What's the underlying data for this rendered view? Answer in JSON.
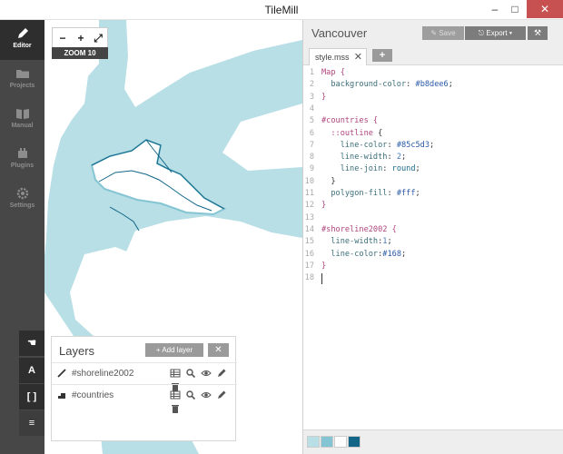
{
  "window": {
    "title": "TileMill",
    "minimize": "–",
    "maximize": "□",
    "close": "✕"
  },
  "sidebar": {
    "items": [
      {
        "label": "Editor",
        "icon": "pencil-icon",
        "active": true
      },
      {
        "label": "Projects",
        "icon": "folder-icon",
        "active": false
      },
      {
        "label": "Manual",
        "icon": "book-icon",
        "active": false
      },
      {
        "label": "Plugins",
        "icon": "plugin-icon",
        "active": false
      },
      {
        "label": "Settings",
        "icon": "gear-icon",
        "active": false
      }
    ]
  },
  "map_tools": {
    "zoom_out": "−",
    "zoom_in": "+",
    "fullscreen": "⤢",
    "zoom_label": "ZOOM 10",
    "pan": "☚",
    "text": "A",
    "braces": "[ ]",
    "layers": "≡"
  },
  "layers_panel": {
    "title": "Layers",
    "add_label": "Add layer",
    "close_label": "✕",
    "layers": [
      {
        "name": "#shoreline2002",
        "icon": "line-icon"
      },
      {
        "name": "#countries",
        "icon": "polygon-icon"
      }
    ]
  },
  "editor": {
    "project_title": "Vancouver",
    "save_label": "Save",
    "export_label": "Export",
    "tab_name": "style.mss",
    "tab_close": "✕",
    "tab_add": "+",
    "lines": [
      {
        "n": "1",
        "parts": [
          [
            "sel",
            "Map {"
          ]
        ]
      },
      {
        "n": "2",
        "parts": [
          [
            "",
            "  "
          ],
          [
            "prop",
            "background-color"
          ],
          [
            "",
            ": "
          ],
          [
            "colr",
            "#b8dee6"
          ],
          [
            "",
            ";"
          ]
        ]
      },
      {
        "n": "3",
        "parts": [
          [
            "sel",
            "}"
          ]
        ]
      },
      {
        "n": "4",
        "parts": []
      },
      {
        "n": "5",
        "parts": [
          [
            "sel",
            "#countries {"
          ]
        ]
      },
      {
        "n": "6",
        "parts": [
          [
            "",
            "  "
          ],
          [
            "sel",
            "::outline"
          ],
          [
            "",
            " {"
          ]
        ]
      },
      {
        "n": "7",
        "parts": [
          [
            "",
            "    "
          ],
          [
            "prop",
            "line-color"
          ],
          [
            "",
            ": "
          ],
          [
            "colr",
            "#85c5d3"
          ],
          [
            "",
            ";"
          ]
        ]
      },
      {
        "n": "8",
        "parts": [
          [
            "",
            "    "
          ],
          [
            "prop",
            "line-width"
          ],
          [
            "",
            ": "
          ],
          [
            "num",
            "2"
          ],
          [
            "",
            ";"
          ]
        ]
      },
      {
        "n": "9",
        "parts": [
          [
            "",
            "    "
          ],
          [
            "prop",
            "line-join"
          ],
          [
            "",
            ": "
          ],
          [
            "kw",
            "round"
          ],
          [
            "",
            ";"
          ]
        ]
      },
      {
        "n": "10",
        "parts": [
          [
            "",
            "  }"
          ]
        ]
      },
      {
        "n": "11",
        "parts": [
          [
            "",
            "  "
          ],
          [
            "prop",
            "polygon-fill"
          ],
          [
            "",
            ": "
          ],
          [
            "colr",
            "#fff"
          ],
          [
            "",
            ";"
          ]
        ]
      },
      {
        "n": "12",
        "parts": [
          [
            "sel",
            "}"
          ]
        ]
      },
      {
        "n": "13",
        "parts": []
      },
      {
        "n": "14",
        "parts": [
          [
            "sel",
            "#shoreline2002 {"
          ]
        ]
      },
      {
        "n": "15",
        "parts": [
          [
            "",
            "  "
          ],
          [
            "prop",
            "line-width"
          ],
          [
            "",
            ":"
          ],
          [
            "num",
            "1"
          ],
          [
            "",
            ";"
          ]
        ]
      },
      {
        "n": "16",
        "parts": [
          [
            "",
            "  "
          ],
          [
            "prop",
            "line-color"
          ],
          [
            "",
            ":"
          ],
          [
            "colr",
            "#168"
          ],
          [
            "",
            ";"
          ]
        ]
      },
      {
        "n": "17",
        "parts": [
          [
            "sel",
            "}"
          ]
        ]
      },
      {
        "n": "18",
        "parts": []
      }
    ]
  },
  "palette": [
    "#b8dee6",
    "#85c5d3",
    "#ffffff",
    "#116688"
  ],
  "colors": {
    "water": "#b8dee6",
    "land": "#ffffff",
    "outline": "#85c5d3",
    "shoreline": "#116688",
    "sidebar": "#474747"
  }
}
